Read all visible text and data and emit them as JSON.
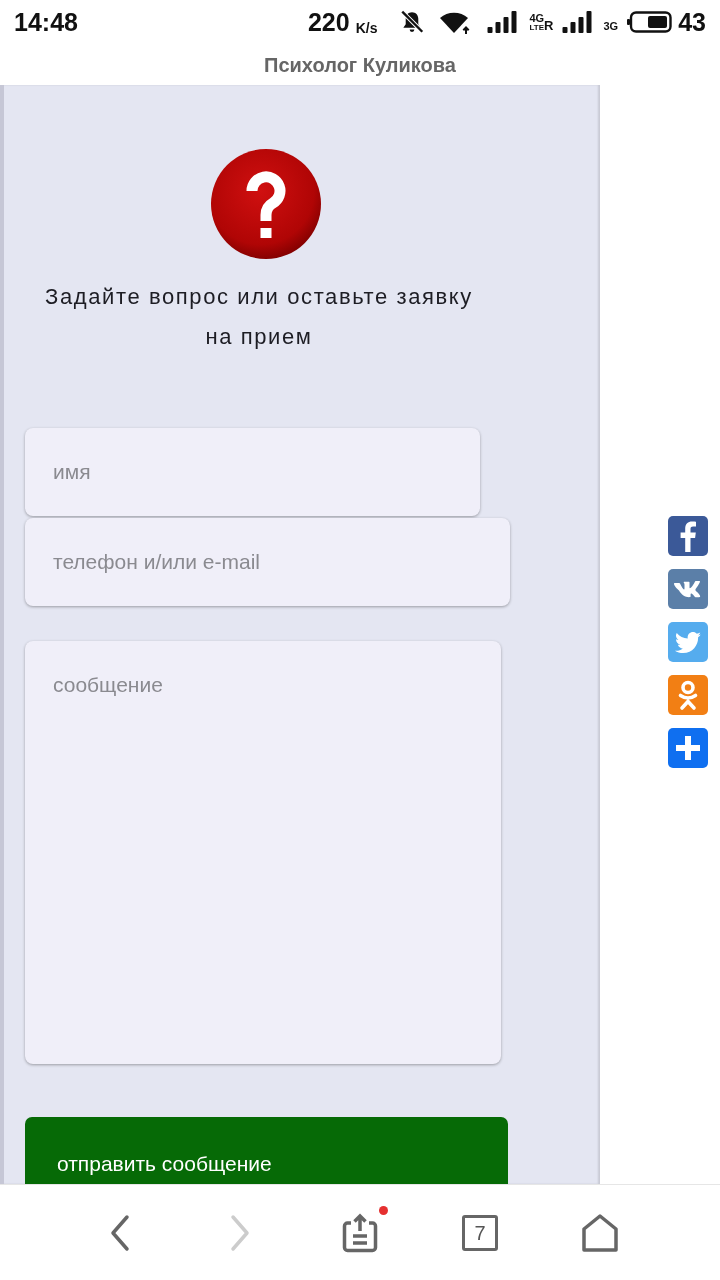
{
  "status_bar": {
    "time": "14:48",
    "speed": "220",
    "speed_unit": "K/s",
    "network_1": {
      "top": "4G",
      "bottom": "LTE",
      "roaming": "R"
    },
    "network_2": "3G",
    "battery": "43"
  },
  "title": "Психолог Куликова",
  "form": {
    "heading": "Задайте вопрос или оставьте заявку на прием",
    "fields": [
      {
        "kind": "input",
        "placeholder": "имя"
      },
      {
        "kind": "input",
        "placeholder": "телефон и/или e-mail"
      },
      {
        "kind": "textarea",
        "placeholder": "сообщение"
      }
    ],
    "submit": "отправить сообщение"
  },
  "nav_bar": {
    "back": {
      "disabled": false
    },
    "forward": {
      "disabled": true
    },
    "share": {
      "badge": true
    },
    "tabs": {
      "count": "7"
    }
  }
}
